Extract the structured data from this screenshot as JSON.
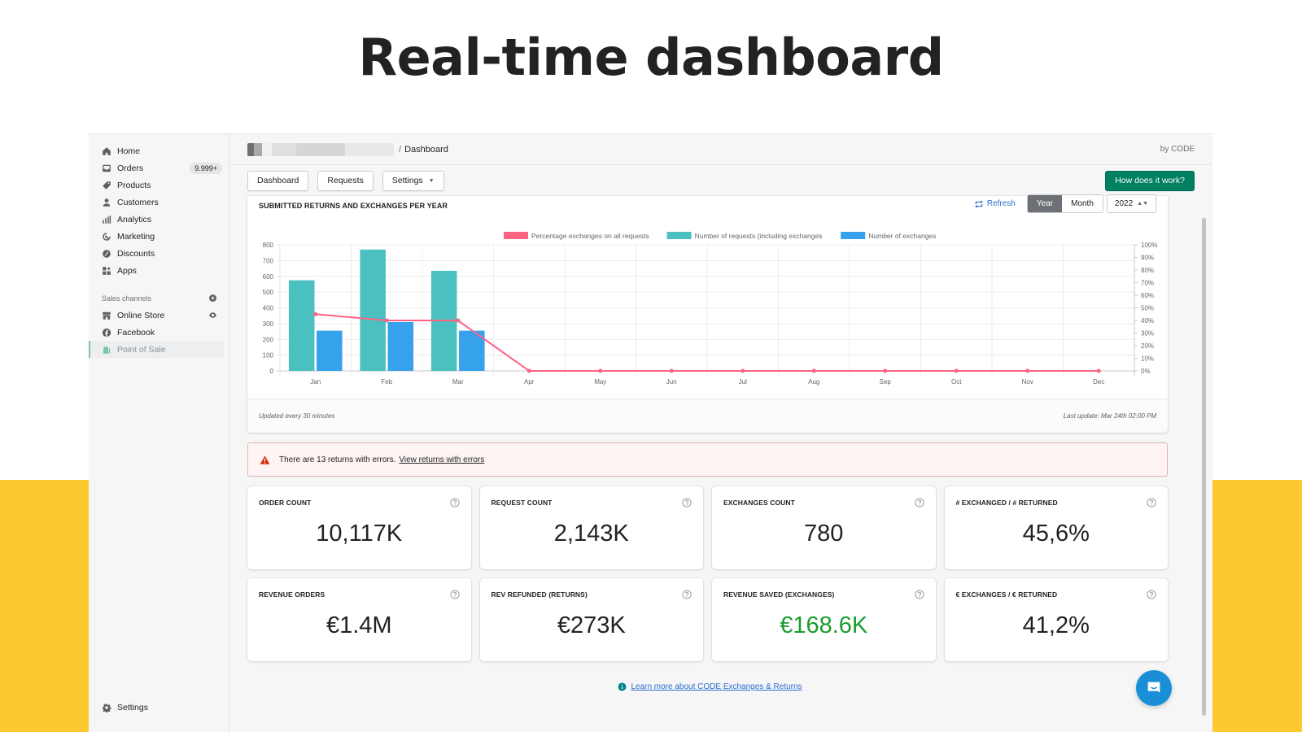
{
  "hero": {
    "title": "Real-time dashboard"
  },
  "sidebar": {
    "items": [
      {
        "label": "Home",
        "icon": "home-icon"
      },
      {
        "label": "Orders",
        "icon": "orders-icon",
        "badge": "9.999+"
      },
      {
        "label": "Products",
        "icon": "tag-icon"
      },
      {
        "label": "Customers",
        "icon": "person-icon"
      },
      {
        "label": "Analytics",
        "icon": "bar-chart-icon"
      },
      {
        "label": "Marketing",
        "icon": "target-icon"
      },
      {
        "label": "Discounts",
        "icon": "discount-icon"
      },
      {
        "label": "Apps",
        "icon": "apps-icon"
      }
    ],
    "sales_channels_label": "Sales channels",
    "channels": [
      {
        "label": "Online Store",
        "icon": "store-icon"
      },
      {
        "label": "Facebook",
        "icon": "facebook-icon"
      },
      {
        "label": "Point of Sale",
        "icon": "pos-icon"
      }
    ],
    "settings_label": "Settings"
  },
  "topbar": {
    "breadcrumb_separator": "/",
    "breadcrumb_current": "Dashboard",
    "by_label": "by CODE"
  },
  "toolbar": {
    "dashboard_label": "Dashboard",
    "requests_label": "Requests",
    "settings_label": "Settings",
    "how_label": "How does it work?"
  },
  "chart_card": {
    "refresh_label": "Refresh",
    "period_options": [
      "Year",
      "Month"
    ],
    "period_selected": "Year",
    "year_value": "2022",
    "footer_left": "Updated every 30 minutes",
    "footer_right": "Last update: Mar 24th 02:00 PM"
  },
  "chart_data": {
    "type": "bar",
    "title": "SUBMITTED RETURNS AND EXCHANGES PER YEAR",
    "categories": [
      "Jan",
      "Feb",
      "Mar",
      "Apr",
      "May",
      "Jun",
      "Jul",
      "Aug",
      "Sep",
      "Oct",
      "Nov",
      "Dec"
    ],
    "series": [
      {
        "name": "Percentage exchanges on all requests",
        "type": "line",
        "axis": "right",
        "color": "#ff6384",
        "values": [
          45,
          40,
          40,
          0,
          0,
          0,
          0,
          0,
          0,
          0,
          0,
          0
        ]
      },
      {
        "name": "Number of requests (including exchanges",
        "type": "bar",
        "axis": "left",
        "color": "#4bc0c0",
        "values": [
          575,
          770,
          635,
          0,
          0,
          0,
          0,
          0,
          0,
          0,
          0,
          0
        ]
      },
      {
        "name": "Number of exchanges",
        "type": "bar",
        "axis": "left",
        "color": "#36a2eb",
        "values": [
          255,
          310,
          255,
          0,
          0,
          0,
          0,
          0,
          0,
          0,
          0,
          0
        ]
      }
    ],
    "y_left": {
      "min": 0,
      "max": 800,
      "ticks": [
        "0",
        "100",
        "200",
        "300",
        "400",
        "500",
        "600",
        "700",
        "800"
      ]
    },
    "y_right": {
      "min": 0,
      "max": 100,
      "ticks": [
        "0%",
        "10%",
        "20%",
        "30%",
        "40%",
        "50%",
        "60%",
        "70%",
        "80%",
        "90%",
        "100%"
      ]
    },
    "grid": true,
    "legend_position": "top"
  },
  "error_banner": {
    "text": "There are 13 returns with errors.",
    "link": "View returns with errors"
  },
  "stats": [
    {
      "label": "ORDER COUNT",
      "value": "10,117K"
    },
    {
      "label": "REQUEST COUNT",
      "value": "2,143K"
    },
    {
      "label": "EXCHANGES COUNT",
      "value": "780"
    },
    {
      "label": "# EXCHANGED / # RETURNED",
      "value": "45,6%"
    },
    {
      "label": "REVENUE ORDERS",
      "value": "€1.4M"
    },
    {
      "label": "REV REFUNDED (RETURNS)",
      "value": "€273K"
    },
    {
      "label": "REVENUE SAVED (EXCHANGES)",
      "value": "€168.6K",
      "highlight": "#1a9d2e"
    },
    {
      "label": "€ EXCHANGES / € RETURNED",
      "value": "41,2%"
    }
  ],
  "learn_more": {
    "text": "Learn more about CODE Exchanges & Returns"
  },
  "colors": {
    "primary": "#008060",
    "link": "#2c6ecb",
    "accent_band": "#fec82f",
    "error_bg": "#fff4f4"
  }
}
